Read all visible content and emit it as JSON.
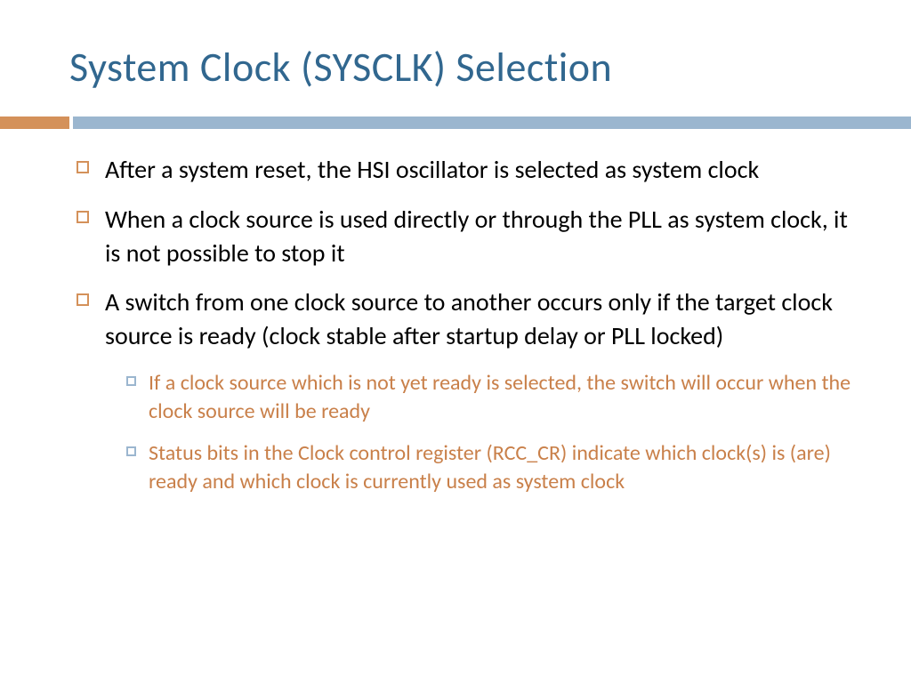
{
  "title": "System Clock (SYSCLK) Selection",
  "bullets": [
    {
      "text": "After a system reset, the HSI oscillator is selected as system clock"
    },
    {
      "text": "When a clock source is used directly or through the PLL as system clock, it is not possible to stop it"
    },
    {
      "text": "A switch from one clock source to another occurs only if the target clock source is ready (clock stable after startup delay or PLL locked)"
    }
  ],
  "subbullets": [
    {
      "text": "If a clock source which is not yet ready is selected, the switch will occur when the clock source will be ready"
    },
    {
      "text": "Status bits in the Clock control register (RCC_CR) indicate which clock(s) is (are) ready and which clock is currently used as system clock"
    }
  ]
}
